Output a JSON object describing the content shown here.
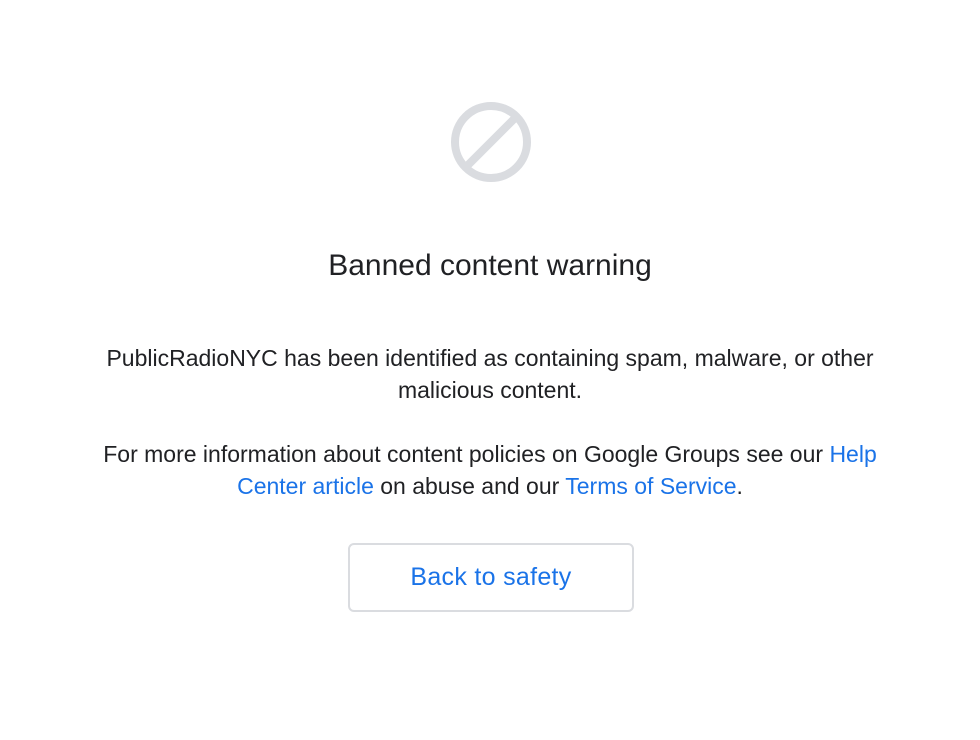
{
  "warning": {
    "icon": "ban-icon",
    "icon_color": "#dadce0",
    "title": "Banned content warning",
    "message": {
      "line": "PublicRadioNYC has been identified as containing spam, malware, or other malicious content."
    },
    "policy": {
      "prefix": "For more information about content policies on Google Groups see our ",
      "help_link": "Help Center article",
      "middle": " on abuse and our ",
      "terms_link": "Terms of Service",
      "suffix": "."
    },
    "back_button": "Back to safety",
    "link_color": "#1a73e8"
  }
}
